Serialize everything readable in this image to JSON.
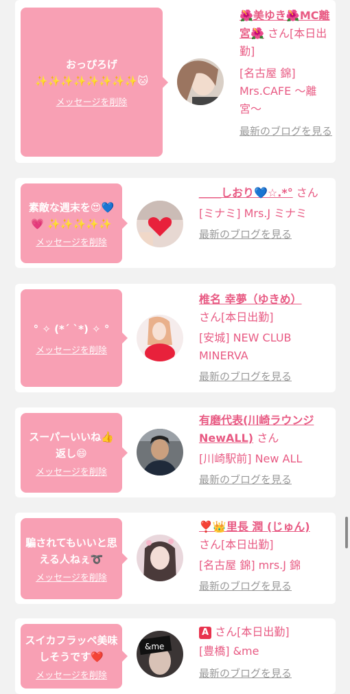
{
  "items": [
    {
      "message": "おっぴろげ ✨✨✨✨✨✨✨✨🐱",
      "delete_label": "メッセージを削除",
      "name": "🌺美ゆき🌺MC離宮🌺",
      "suffix": " さん[本日出勤]",
      "shop": "[名古屋 錦] Mrs.CAFE 〜離宮〜",
      "blog_label": "最新のブログを見る"
    },
    {
      "message": "素敵な週末を😍💙💗 ✨✨✨✨✨",
      "delete_label": "メッセージを削除",
      "name": "＿＿しおり💙☆.*°",
      "suffix": " さん",
      "shop": "[ミナミ] Mrs.J ミナミ",
      "blog_label": "最新のブログを見る"
    },
    {
      "message": "° ✧ (*´ `*) ✧ °",
      "delete_label": "メッセージを削除",
      "name": "椎名 幸夢（ゆきめ）",
      "suffix": " さん[本日出勤]",
      "shop": "[安城] NEW CLUB MINERVA",
      "blog_label": "最新のブログを見る"
    },
    {
      "message": "スーパーいいね👍返し😄",
      "delete_label": "メッセージを削除",
      "name": "有磨代表(川崎ラウンジNewALL)",
      "suffix": " さん",
      "shop": "[川崎駅前] New ALL",
      "blog_label": "最新のブログを見る"
    },
    {
      "message": "騙されてもいいと思える人ねぇ➰",
      "delete_label": "メッセージを削除",
      "name": "❣️👑里長 潤 (じゅん)",
      "suffix": " さん[本日出勤]",
      "shop": "[名古屋 錦] mrs.J 錦",
      "blog_label": "最新のブログを見る"
    },
    {
      "message": "スイカフラッペ美味しそうです❤️",
      "delete_label": "メッセージを削除",
      "name": "A",
      "suffix": " さん[本日出勤]",
      "shop": "[豊橋] &me",
      "blog_label": "最新のブログを見る"
    }
  ],
  "avatars": [
    "woman-portrait",
    "heart-photo",
    "woman-in-red",
    "man-portrait",
    "woman-closeup",
    "andme-logo"
  ],
  "avatar_logo_text": "&me",
  "colors": {
    "accent": "#e85a83",
    "bubble": "#f8a0b4",
    "muted": "#999999"
  }
}
